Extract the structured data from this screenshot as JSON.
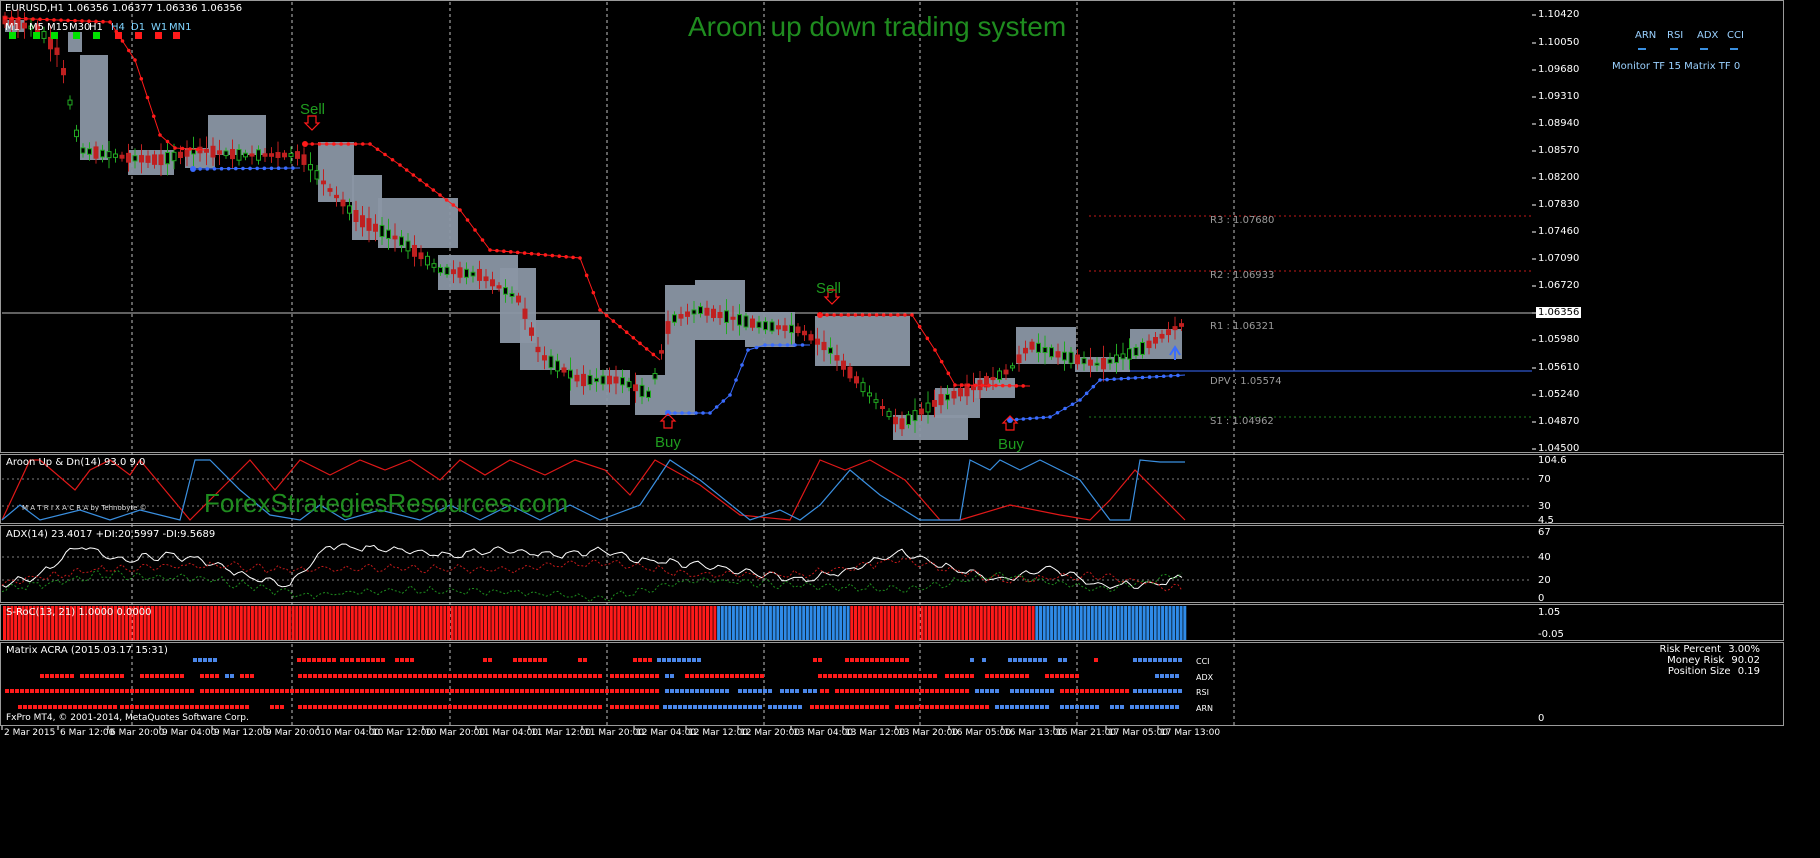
{
  "window": {
    "symbol_header": "EURUSD,H1  1.06356 1.06377 1.06336 1.06356",
    "title": "Aroon up down trading system",
    "watermark": "ForexStrategiesResources.com",
    "matrix_brand": "M A T R I X   A C R A by Tehnobyte ©",
    "footer": "FxPro MT4, © 2001-2014, MetaQuotes Software Corp."
  },
  "timeframes": [
    "M1",
    "M5",
    "M15",
    "M30",
    "H1",
    "H4",
    "D1",
    "W1",
    "MN1"
  ],
  "timeframe_status": [
    "green",
    "green",
    "green",
    "green",
    "green",
    "red",
    "red",
    "red",
    "red"
  ],
  "monitor": {
    "headers": [
      "ARN",
      "RSI",
      "ADX",
      "CCI"
    ],
    "status_text": "Monitor TF 15  Matrix TF 0"
  },
  "colors": {
    "sell": "#ff1a1a",
    "buy": "#3a6cff",
    "box": "#8a96a4",
    "signal_text": "#1f9c1f",
    "bear_candle": "#c02020",
    "bull_candle": "#22aa22",
    "aroon_up": "#3a8fe0",
    "aroon_down": "#e01818",
    "adx_main": "#ffffff",
    "adx_plus": "#1e8e1e",
    "adx_minus": "#c41a1a",
    "roc_red": "#ff1a1a",
    "roc_blue": "#2f8be8"
  },
  "main_chart": {
    "price_ticks": [
      "1.10420",
      "1.10050",
      "1.09680",
      "1.09310",
      "1.08940",
      "1.08570",
      "1.08200",
      "1.07830",
      "1.07460",
      "1.07090",
      "1.06720",
      "1.06356",
      "1.05980",
      "1.05610",
      "1.05240",
      "1.04870",
      "1.04500"
    ],
    "current_price": "1.06356",
    "pivots": [
      {
        "label": "R3 : 1.07680",
        "color": "#c41a1a"
      },
      {
        "label": "R2 : 1.06933",
        "color": "#c41a1a"
      },
      {
        "label": "R1 : 1.06321",
        "color": "#808080"
      },
      {
        "label": "DPV : 1.05574",
        "color": "#808080"
      },
      {
        "label": "S1 : 1.04962",
        "color": "#1e7e1e"
      }
    ],
    "signals": [
      {
        "type": "sell",
        "text": "Sell"
      },
      {
        "type": "sell",
        "text": "Sell"
      },
      {
        "type": "buy",
        "text": "Buy"
      },
      {
        "type": "buy",
        "text": "Buy"
      }
    ]
  },
  "aroon": {
    "label": "Aroon Up & Dn(14) 93.0 9.0",
    "ticks": [
      "104.6",
      "70",
      "30",
      "4.5"
    ]
  },
  "adx": {
    "label": "ADX(14) 23.4017 +DI:20.5997 -DI:9.5689",
    "ticks": [
      "67",
      "40",
      "20",
      "0"
    ]
  },
  "sroc": {
    "label": "S-RoC(13, 21) 1.0000 0.0000",
    "ticks": [
      "1.05",
      "-0.05"
    ]
  },
  "matrix": {
    "label": "Matrix ACRA (2015.03.17 15:31)",
    "rows": [
      "CCI",
      "ADX",
      "RSI",
      "ARN"
    ],
    "axis_tick": "0",
    "risk": [
      {
        "name": "Risk Percent",
        "value": "3.00%"
      },
      {
        "name": "Money Risk",
        "value": "90.02"
      },
      {
        "name": "Position Size",
        "value": "0.19"
      }
    ]
  },
  "time_axis": [
    "2 Mar 2015",
    "6 Mar 12:00",
    "6 Mar 20:00",
    "9 Mar 04:00",
    "9 Mar 12:00",
    "9 Mar 20:00",
    "10 Mar 04:00",
    "10 Mar 12:00",
    "10 Mar 20:00",
    "11 Mar 04:00",
    "11 Mar 12:00",
    "11 Mar 20:00",
    "12 Mar 04:00",
    "12 Mar 12:00",
    "12 Mar 20:00",
    "13 Mar 04:00",
    "13 Mar 12:00",
    "13 Mar 20:00",
    "16 Mar 05:00",
    "16 Mar 13:00",
    "16 Mar 21:00",
    "17 Mar 05:00",
    "17 Mar 13:00"
  ]
}
